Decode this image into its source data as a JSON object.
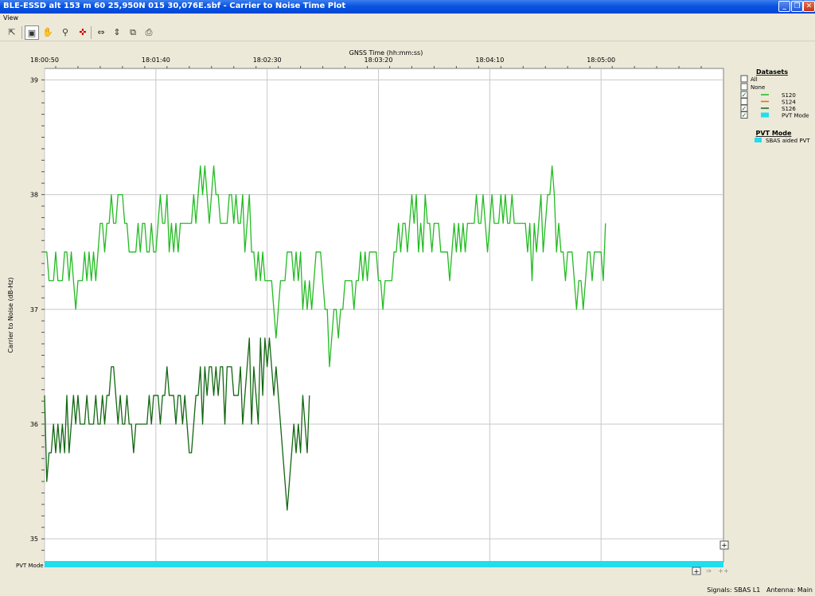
{
  "window": {
    "title": "BLE-ESSD alt 153 m 60 25,950N 015 30,076E.sbf - Carrier to Noise Time Plot",
    "icon": "ble-app-icon",
    "buttons": {
      "minimize": "_",
      "restore": "❐",
      "close": "✕"
    }
  },
  "menu": {
    "items": [
      "View"
    ]
  },
  "toolbar": {
    "buttons": [
      {
        "name": "select-tool-icon",
        "glyph": "⇱"
      },
      {
        "name": "zoom-window-icon",
        "glyph": "▣"
      },
      {
        "name": "pan-hand-icon",
        "glyph": "✋"
      },
      {
        "name": "zoom-tool-icon",
        "glyph": "⚲"
      },
      {
        "name": "fit-all-icon",
        "glyph": "✜"
      },
      {
        "name": "fit-horizontal-icon",
        "glyph": "⇔"
      },
      {
        "name": "fit-vertical-icon",
        "glyph": "⇕"
      },
      {
        "name": "copy-icon",
        "glyph": "⧉"
      },
      {
        "name": "print-icon",
        "glyph": "⎙"
      }
    ]
  },
  "legend": {
    "datasets_title": "Datasets",
    "all_label": "All",
    "none_label": "None",
    "items": [
      {
        "label": "S120",
        "color": "#22bb22",
        "checked": true
      },
      {
        "label": "S124",
        "color": "#ff6600",
        "checked": false
      },
      {
        "label": "S126",
        "color": "#116611",
        "checked": true
      },
      {
        "label": "PVT Mode",
        "color": "#22ddee",
        "checked": true
      }
    ],
    "pvt_title": "PVT Mode",
    "pvt_items": [
      {
        "label": "SBAS aided PVT",
        "color": "#22ddee"
      }
    ]
  },
  "status": {
    "signals": "Signals: SBAS L1",
    "antenna": "Antenna: Main"
  },
  "chart_data": {
    "type": "line",
    "xlabel": "GNSS Time (hh:mm:ss)",
    "ylabel": "Carrier to Noise (dB-Hz)",
    "pvt_row_label": "PVT Mode",
    "x_ticks": [
      "18:00:50",
      "18:01:40",
      "18:02:30",
      "18:03:20",
      "18:04:10",
      "18:05:00"
    ],
    "x_tick_seconds": [
      50,
      100,
      150,
      200,
      250,
      300
    ],
    "xlim_seconds": [
      50,
      355
    ],
    "ylim": [
      34.8,
      39.1
    ],
    "y_ticks": [
      35,
      36,
      37,
      38,
      39
    ],
    "grid": true,
    "legend_position": "right",
    "series": [
      {
        "name": "S120",
        "color": "#22bb22",
        "values": [
          37.5,
          37.5,
          37.25,
          37.25,
          37.25,
          37.5,
          37.25,
          37.25,
          37.25,
          37.5,
          37.5,
          37.25,
          37.5,
          37.25,
          37.0,
          37.25,
          37.25,
          37.25,
          37.5,
          37.25,
          37.5,
          37.25,
          37.5,
          37.25,
          37.5,
          37.75,
          37.75,
          37.5,
          37.75,
          37.75,
          38.0,
          37.75,
          37.75,
          38.0,
          38.0,
          38.0,
          37.75,
          37.75,
          37.5,
          37.5,
          37.5,
          37.5,
          37.75,
          37.5,
          37.75,
          37.75,
          37.5,
          37.5,
          37.75,
          37.5,
          37.5,
          37.75,
          38.0,
          37.75,
          37.75,
          38.0,
          37.5,
          37.75,
          37.5,
          37.75,
          37.5,
          37.75,
          37.75,
          37.75,
          37.75,
          37.75,
          37.75,
          38.0,
          37.75,
          38.0,
          38.25,
          38.0,
          38.25,
          38.0,
          37.75,
          38.0,
          38.25,
          38.0,
          38.0,
          37.75,
          37.75,
          37.75,
          37.75,
          38.0,
          38.0,
          37.75,
          38.0,
          37.75,
          37.75,
          38.0,
          37.5,
          37.75,
          38.0,
          37.5,
          37.5,
          37.25,
          37.5,
          37.25,
          37.5,
          37.25,
          37.25,
          37.25,
          37.25,
          37.0,
          36.75,
          37.0,
          37.25,
          37.25,
          37.25,
          37.5,
          37.5,
          37.5,
          37.25,
          37.5,
          37.25,
          37.5,
          37.0,
          37.25,
          37.0,
          37.25,
          37.0,
          37.25,
          37.5,
          37.5,
          37.5,
          37.25,
          37.0,
          37.0,
          36.5,
          36.75,
          37.0,
          37.0,
          36.75,
          37.0,
          37.0,
          37.25,
          37.25,
          37.25,
          37.25,
          37.0,
          37.25,
          37.25,
          37.5,
          37.25,
          37.5,
          37.25,
          37.5,
          37.5,
          37.5,
          37.5,
          37.25,
          37.25,
          37.0,
          37.25,
          37.25,
          37.25,
          37.25,
          37.5,
          37.5,
          37.75,
          37.5,
          37.75,
          37.75,
          37.5,
          37.75,
          38.0,
          37.75,
          38.0,
          37.5,
          37.75,
          37.5,
          38.0,
          37.75,
          37.75,
          37.5,
          37.75,
          37.75,
          37.75,
          37.5,
          37.5,
          37.5,
          37.5,
          37.25,
          37.5,
          37.75,
          37.5,
          37.75,
          37.5,
          37.75,
          37.5,
          37.75,
          37.75,
          37.75,
          37.75,
          38.0,
          37.75,
          37.75,
          38.0,
          37.75,
          37.5,
          37.75,
          38.0,
          37.75,
          37.75,
          37.75,
          38.0,
          37.75,
          38.0,
          37.75,
          37.75,
          38.0,
          37.75,
          37.75,
          37.75,
          37.75,
          37.75,
          37.75,
          37.5,
          37.75,
          37.25,
          37.75,
          37.5,
          37.75,
          38.0,
          37.5,
          37.75,
          38.0,
          38.0,
          38.25,
          38.0,
          37.5,
          37.75,
          37.5,
          37.5,
          37.25,
          37.5,
          37.5,
          37.5,
          37.25,
          37.0,
          37.25,
          37.25,
          37.0,
          37.25,
          37.5,
          37.5,
          37.25,
          37.5,
          37.5,
          37.5,
          37.5,
          37.25,
          37.75
        ]
      },
      {
        "name": "S126",
        "color": "#116611",
        "values": [
          36.25,
          35.5,
          35.75,
          35.75,
          36.0,
          35.75,
          36.0,
          35.75,
          36.0,
          35.75,
          36.25,
          35.75,
          36.0,
          36.25,
          36.0,
          36.25,
          36.0,
          36.0,
          36.0,
          36.25,
          36.0,
          36.0,
          36.0,
          36.25,
          36.0,
          36.0,
          36.25,
          36.0,
          36.25,
          36.25,
          36.5,
          36.5,
          36.25,
          36.0,
          36.25,
          36.0,
          36.0,
          36.25,
          36.0,
          36.0,
          35.75,
          36.0,
          36.0,
          36.0,
          36.0,
          36.0,
          36.0,
          36.25,
          36.0,
          36.25,
          36.25,
          36.25,
          36.0,
          36.25,
          36.25,
          36.5,
          36.25,
          36.25,
          36.25,
          36.0,
          36.25,
          36.25,
          36.0,
          36.25,
          36.0,
          35.75,
          35.75,
          36.0,
          36.25,
          36.25,
          36.5,
          36.0,
          36.5,
          36.25,
          36.5,
          36.5,
          36.25,
          36.5,
          36.25,
          36.5,
          36.5,
          36.0,
          36.5,
          36.5,
          36.5,
          36.25,
          36.25,
          36.25,
          36.5,
          36.0,
          36.25,
          36.5,
          36.75,
          36.0,
          36.5,
          36.25,
          36.0,
          36.75,
          36.25,
          36.75,
          36.5,
          36.75,
          36.5,
          36.25,
          36.5,
          36.25,
          36.0,
          35.75,
          35.5,
          35.25,
          35.5,
          35.75,
          36.0,
          35.75,
          36.0,
          35.75,
          36.25,
          36.0,
          35.75,
          36.25
        ]
      }
    ],
    "pvt_mode": [
      {
        "label": "SBAS aided PVT",
        "color": "#22ddee"
      }
    ]
  }
}
